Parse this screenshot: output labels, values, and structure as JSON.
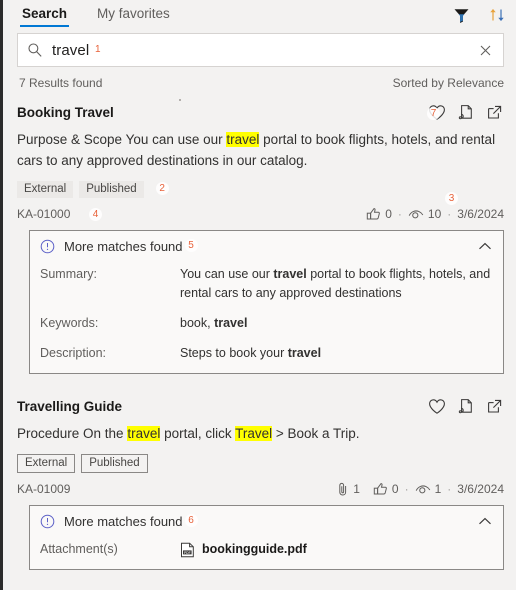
{
  "tabs": [
    {
      "label": "Search",
      "active": true
    },
    {
      "label": "My favorites",
      "active": false
    }
  ],
  "toolbar": {
    "filter_icon": "filter-icon",
    "sort_icon": "sort-icon"
  },
  "search": {
    "icon": "search-icon",
    "value": "travel",
    "placeholder": "Search",
    "clear_icon": "close-icon",
    "marker": "1"
  },
  "results_summary": {
    "count_label": "7 Results found",
    "sort_label": "Sorted by Relevance"
  },
  "results": [
    {
      "title": "Booking Travel",
      "snippet_parts": [
        {
          "text": "Purpose & Scope You can use our ",
          "highlight": false
        },
        {
          "text": "travel",
          "highlight": true
        },
        {
          "text": " portal to book flights, hotels, and rental cars to any approved destinations in our catalog.",
          "highlight": false
        }
      ],
      "tags": [
        {
          "label": "External",
          "style": "filled"
        },
        {
          "label": "Published",
          "style": "filled"
        }
      ],
      "tags_marker": "2",
      "article_id": "KA-01000",
      "article_id_marker": "4",
      "stats_marker": "3",
      "actions_marker": "7",
      "attachments_count": null,
      "likes": "0",
      "views": "10",
      "date": "3/6/2024",
      "actions": [
        {
          "name": "favorite-icon",
          "label": "Add to favorites"
        },
        {
          "name": "copy-link-icon",
          "label": "Copy link"
        },
        {
          "name": "open-in-new-icon",
          "label": "Open in new window"
        }
      ],
      "matches": {
        "label": "More matches found",
        "marker": "5",
        "expanded": true,
        "rows": [
          {
            "key": "Summary:",
            "value_parts": [
              {
                "text": "You can use our ",
                "bold": false
              },
              {
                "text": "travel",
                "bold": true
              },
              {
                "text": " portal to book flights, hotels, and rental cars to any approved destinations",
                "bold": false
              }
            ]
          },
          {
            "key": "Keywords:",
            "value_parts": [
              {
                "text": "book, ",
                "bold": false
              },
              {
                "text": "travel",
                "bold": true
              }
            ]
          },
          {
            "key": "Description:",
            "value_parts": [
              {
                "text": "Steps to book your ",
                "bold": false
              },
              {
                "text": "travel",
                "bold": true
              }
            ]
          }
        ]
      }
    },
    {
      "title": "Travelling Guide",
      "snippet_parts": [
        {
          "text": "Procedure On the ",
          "highlight": false
        },
        {
          "text": "travel",
          "highlight": true
        },
        {
          "text": " portal, click ",
          "highlight": false
        },
        {
          "text": "Travel",
          "highlight": true
        },
        {
          "text": " > Book a Trip.",
          "highlight": false
        }
      ],
      "tags": [
        {
          "label": "External",
          "style": "outlined"
        },
        {
          "label": "Published",
          "style": "outlined"
        }
      ],
      "tags_marker": null,
      "article_id": "KA-01009",
      "article_id_marker": null,
      "stats_marker": null,
      "actions_marker": null,
      "attachments_count": "1",
      "likes": "0",
      "views": "1",
      "date": "3/6/2024",
      "actions": [
        {
          "name": "favorite-icon",
          "label": "Add to favorites"
        },
        {
          "name": "copy-link-icon",
          "label": "Copy link"
        },
        {
          "name": "open-in-new-icon",
          "label": "Open in new window"
        }
      ],
      "matches": {
        "label": "More matches found",
        "marker": "6",
        "expanded": true,
        "rows": [
          {
            "key": "Attachment(s)",
            "attachment": {
              "filename": "bookingguide.pdf",
              "icon": "pdf-file-icon"
            }
          }
        ]
      }
    }
  ],
  "colors": {
    "accent": "#0078d4",
    "highlight": "#ffff00",
    "marker": "#e8623a",
    "page_bg": "#f3f2f1",
    "panel_bg": "#faf9f8",
    "border": "#8a8886"
  }
}
